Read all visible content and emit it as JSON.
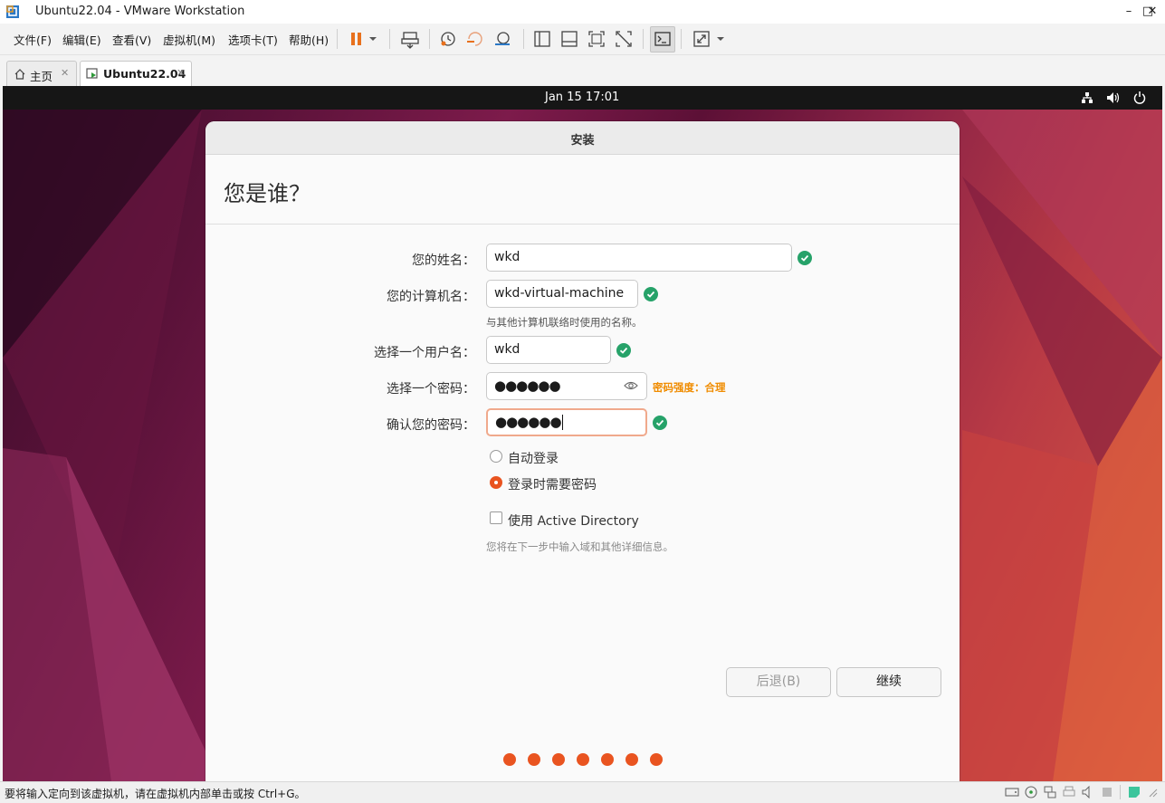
{
  "window": {
    "title": "Ubuntu22.04 - VMware Workstation",
    "minimize": "–",
    "maximize": "□",
    "close": "✕"
  },
  "menu": {
    "file": "文件(F)",
    "edit": "编辑(E)",
    "view": "查看(V)",
    "vm": "虚拟机(M)",
    "tabs": "选项卡(T)",
    "help": "帮助(H)"
  },
  "tabs": [
    {
      "label": "主页",
      "close": "✕"
    },
    {
      "label": "Ubuntu22.04",
      "close": "✕"
    }
  ],
  "guest": {
    "clock": "Jan 15  17:01"
  },
  "installer": {
    "window_title": "安装",
    "heading": "您是谁？",
    "name_label": "您的姓名：",
    "name_value": "wkd",
    "computer_label": "您的计算机名：",
    "computer_value": "wkd-virtual-machine",
    "computer_hint": "与其他计算机联络时使用的名称。",
    "username_label": "选择一个用户名：",
    "username_value": "wkd",
    "password_label": "选择一个密码：",
    "password_value": "●●●●●●",
    "password_strength": "密码强度：合理",
    "confirm_label": "确认您的密码：",
    "confirm_value": "●●●●●●",
    "auto_login": "自动登录",
    "require_password": "登录时需要密码",
    "active_directory": "使用 Active Directory",
    "ad_hint": "您将在下一步中输入域和其他详细信息。",
    "back_button": "后退(B)",
    "continue_button": "继续",
    "progress_steps": 7
  },
  "status": {
    "text": "要将输入定向到该虚拟机，请在虚拟机内部单击或按 Ctrl+G。"
  },
  "colors": {
    "accent": "#e95420",
    "valid": "#26a269",
    "strength": "#f08c00"
  }
}
